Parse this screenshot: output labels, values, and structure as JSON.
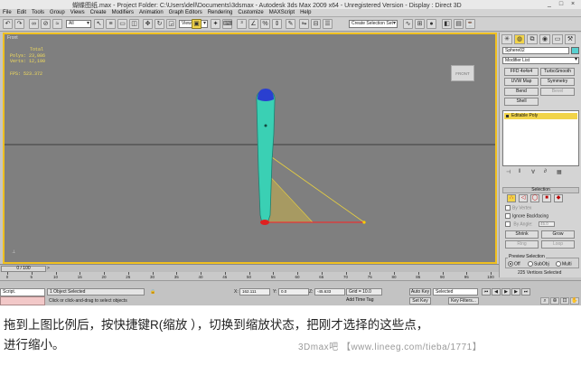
{
  "window": {
    "title": "蝴蝶图纸.max    - Project Folder: C:\\Users\\dell\\Documents\\3dsmax    - Autodesk 3ds Max  2009 x64  - Unregistered Version    - Display : Direct 3D",
    "controls": [
      "_",
      "□",
      "×"
    ]
  },
  "menu": [
    "File",
    "Edit",
    "Tools",
    "Group",
    "Views",
    "Create",
    "Modifiers",
    "Animation",
    "Graph Editors",
    "Rendering",
    "Customize",
    "MAXScript",
    "Help"
  ],
  "toolbar": {
    "filter": "All",
    "coord_system": "View",
    "selection_set": "Create Selection Set"
  },
  "viewport": {
    "label": "Front",
    "stats": {
      "header": "Total",
      "polys": "Polys: 23,086",
      "verts": "Verts: 12,190",
      "fps": "FPS:  523.372"
    },
    "viewcube": "FRONT",
    "accent": "#f0c020"
  },
  "command_panel": {
    "object_name": "Sphere02",
    "object_color": "#58d0d0",
    "modifier_list": "Modifier List",
    "buttons": [
      "FFD 4x4x4",
      "TurboSmooth",
      "UVW Map",
      "Symmetry",
      "Bend",
      "Bevel",
      "Shell"
    ],
    "stack_item": "Editable Poly",
    "selection": {
      "title": "Selection",
      "by_vertex": "By Vertex",
      "ignore_backfacing": "Ignore Backfacing",
      "by_angle": "By Angle:",
      "angle_value": "45.0",
      "shrink": "Shrink",
      "grow": "Grow",
      "ring": "Ring",
      "loop": "Loop",
      "preview_title": "Preview Selection",
      "preview_off": "Off",
      "preview_subobj": "SubObj",
      "preview_multi": "Multi",
      "selected_count": "225 Vertices Selected"
    }
  },
  "timeline": {
    "slider_label": "0 / 100",
    "ticks": [
      0,
      5,
      10,
      15,
      20,
      25,
      30,
      35,
      40,
      45,
      50,
      55,
      60,
      65,
      70,
      75,
      80,
      85,
      90,
      95,
      100
    ]
  },
  "status": {
    "script_label": "Script.",
    "selection": "1 Object Selected",
    "prompt": "Click or click-and-drag to select objects",
    "x_label": "X:",
    "x_value": "162.111",
    "y_label": "Y:",
    "y_value": "0.0",
    "z_label": "Z:",
    "z_value": "-45.633",
    "grid": "Grid = 10.0",
    "add_time_tag": "Add Time Tag",
    "auto_key": "Auto Key",
    "set_key": "Set Key",
    "key_mode": "Selected",
    "key_filters": "Key Filters..."
  },
  "caption": {
    "line1": "拖到上图比例后，按快捷键R(缩放 ），切换到缩放状态，把刚才选择的这些点，",
    "line2": "进行缩小。"
  },
  "watermark": "3Dmax吧 【www.lineeg.com/tieba/1771】"
}
